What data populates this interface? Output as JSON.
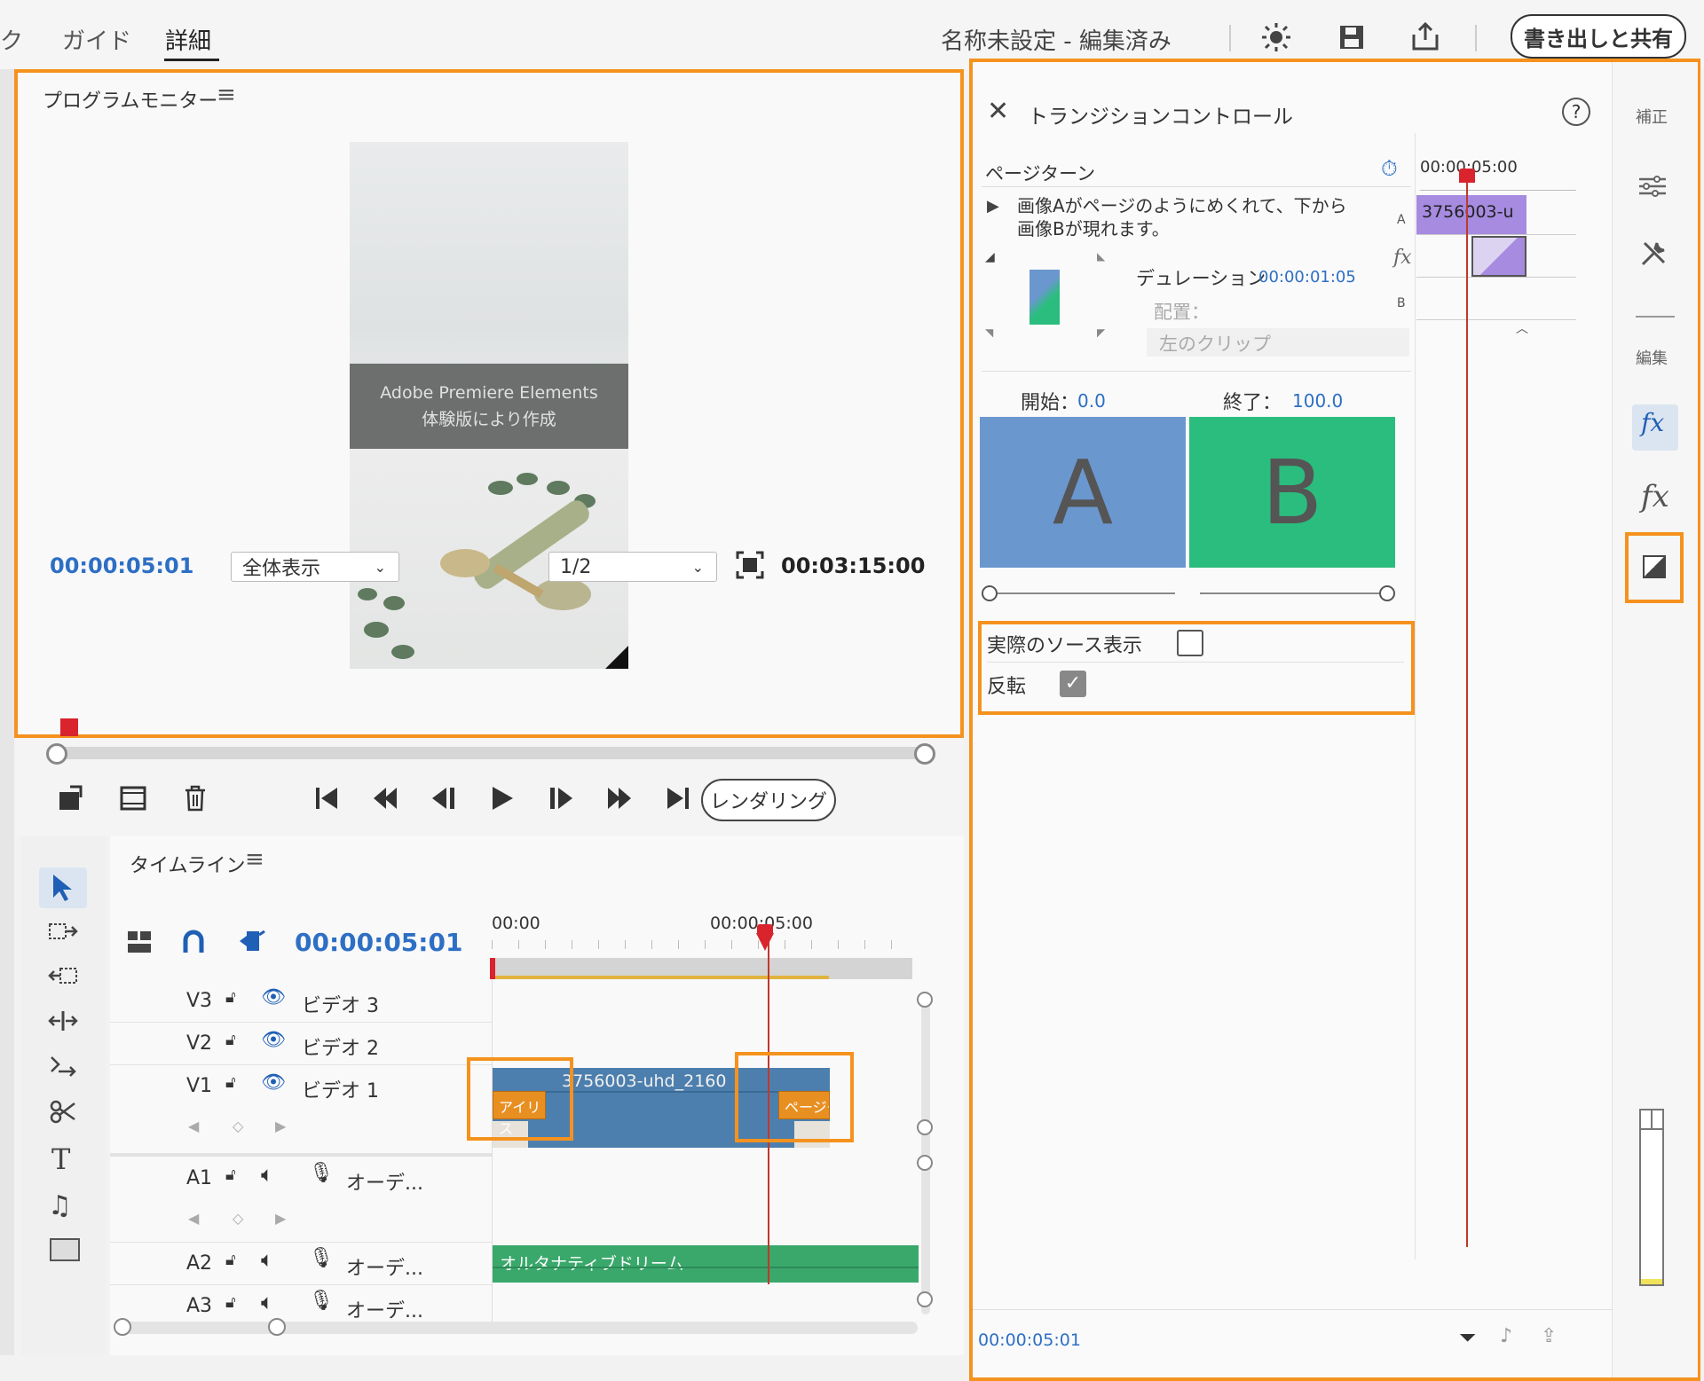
{
  "top": {
    "tabs": [
      "ク",
      "ガイド",
      "詳細"
    ],
    "project_title": "名称未設定 - 編集済み",
    "export_label": "書き出しと共有"
  },
  "monitor": {
    "title": "プログラムモニター",
    "watermark_line1": "Adobe Premiere Elements",
    "watermark_line2": "体験版により作成",
    "current_time": "00:00:05:01",
    "zoom_option": "全体表示",
    "quality_option": "1/2",
    "total_time": "00:03:15:00",
    "render_label": "レンダリング"
  },
  "timeline": {
    "title": "タイムライン",
    "current_time": "00:00:05:01",
    "ruler": [
      "00:00",
      "00:00:05:00"
    ],
    "tracks": [
      {
        "id": "V3",
        "name": "ビデオ 3"
      },
      {
        "id": "V2",
        "name": "ビデオ 2"
      },
      {
        "id": "V1",
        "name": "ビデオ 1"
      },
      {
        "id": "A1",
        "name": "オーデ..."
      },
      {
        "id": "A2",
        "name": "オーデ..."
      },
      {
        "id": "A3",
        "name": "オーデ..."
      }
    ],
    "video_clip": "3756003-uhd_2160",
    "transition_left": "アイリス",
    "transition_right": "ページタ",
    "audio_clip": "オルタナティブドリーム"
  },
  "transition": {
    "title": "トランジションコントロール",
    "effect_name": "ページターン",
    "description_line1": "画像Aがページのようにめくれて、下から",
    "description_line2": "画像Bが現れます。",
    "duration_label": "デュレーション",
    "duration_value": "00:00:01:05",
    "alignment_label": "配置：",
    "alignment_value": "左のクリップ",
    "start_label": "開始：",
    "start_value": "0.0",
    "end_label": "終了：",
    "end_value": "100.0",
    "a_label": "A",
    "b_label": "B",
    "show_source_label": "実際のソース表示",
    "show_source_checked": false,
    "reverse_label": "反転",
    "reverse_checked": true,
    "mini_time": "00:00:05:00",
    "mini_clip": "3756003-u",
    "track_a": "A",
    "track_b": "B",
    "fx_letters": "fx",
    "footer_time": "00:00:05:01"
  },
  "rightbar": {
    "adjust_label": "補正",
    "edit_label": "編集"
  },
  "colors": {
    "accent_orange": "#f5921e",
    "time_blue": "#2d6fc4",
    "a_color": "#6b97cf",
    "b_color": "#2bbd7e",
    "clip_blue": "#4d7fae",
    "audio_green": "#3aa86b",
    "playhead_red": "#d9232d"
  }
}
